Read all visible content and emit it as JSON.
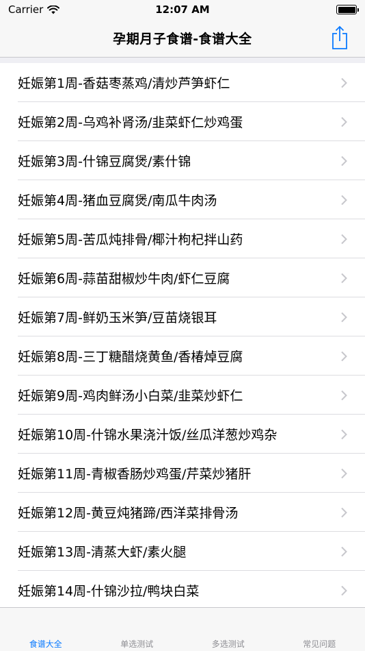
{
  "status_bar": {
    "carrier": "Carrier",
    "time": "12:07 AM"
  },
  "nav": {
    "title": "孕期月子食谱-食谱大全"
  },
  "recipes": [
    "妊娠第1周-香菇枣蒸鸡/清炒芦笋虾仁",
    "妊娠第2周-乌鸡补肾汤/韭菜虾仁炒鸡蛋",
    "妊娠第3周-什锦豆腐煲/素什锦",
    "妊娠第4周-猪血豆腐煲/南瓜牛肉汤",
    "妊娠第5周-苦瓜炖排骨/椰汁枸杞拌山药",
    "妊娠第6周-蒜苗甜椒炒牛肉/虾仁豆腐",
    "妊娠第7周-鲜奶玉米笋/豆苗烧银耳",
    "妊娠第8周-三丁糖醋烧黄鱼/香椿焯豆腐",
    "妊娠第9周-鸡肉鲜汤小白菜/韭菜炒虾仁",
    "妊娠第10周-什锦水果浇汁饭/丝瓜洋葱炒鸡杂",
    "妊娠第11周-青椒香肠炒鸡蛋/芹菜炒猪肝",
    "妊娠第12周-黄豆炖猪蹄/西洋菜排骨汤",
    "妊娠第13周-清蒸大虾/素火腿",
    "妊娠第14周-什锦沙拉/鸭块白菜"
  ],
  "tabs": [
    {
      "label": "食谱大全",
      "active": true
    },
    {
      "label": "单选测试",
      "active": false
    },
    {
      "label": "多选测试",
      "active": false
    },
    {
      "label": "常见问题",
      "active": false
    }
  ],
  "colors": {
    "accent": "#0a7aff",
    "tab_inactive": "#8e8e93",
    "chevron": "#c7c7cc"
  }
}
